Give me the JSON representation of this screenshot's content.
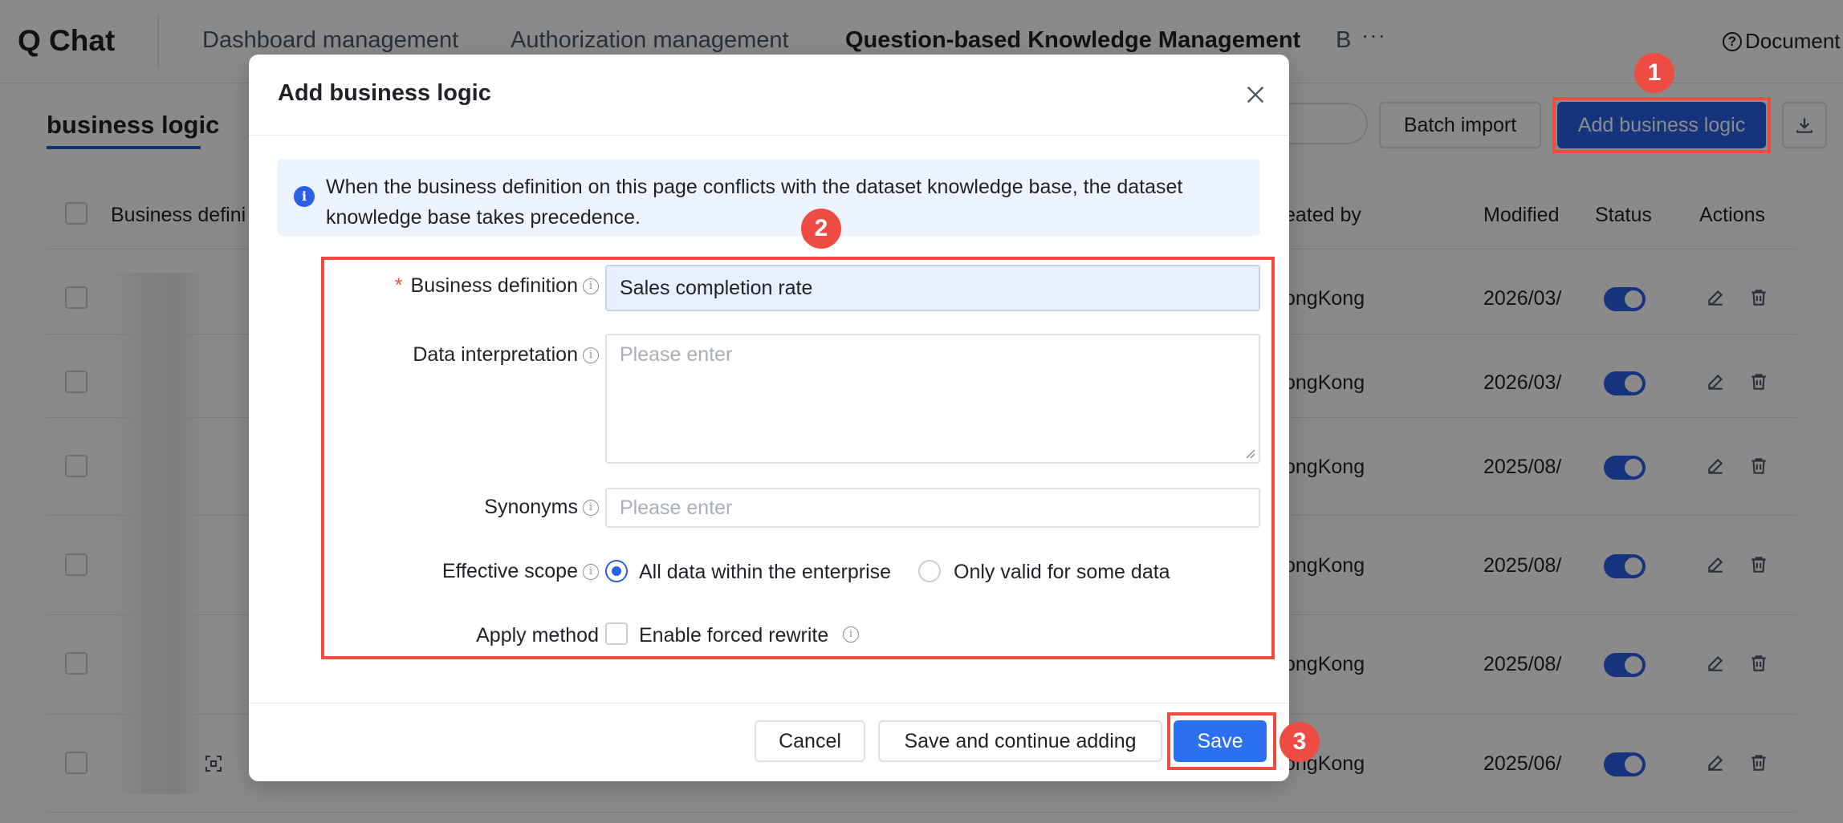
{
  "app": {
    "title": "Q Chat"
  },
  "nav": {
    "tabs": [
      {
        "label": "Dashboard management"
      },
      {
        "label": "Authorization management"
      },
      {
        "label": "Question-based Knowledge Management"
      },
      {
        "label": "B"
      }
    ],
    "more": "···",
    "document": "Document"
  },
  "page": {
    "subtab": "business logic",
    "batch_import": "Batch import",
    "add_button": "Add business logic"
  },
  "table": {
    "columns": {
      "business_definition": "Business defini",
      "created_by": "eated by",
      "modified": "Modified",
      "status": "Status",
      "actions": "Actions"
    },
    "rows": [
      {
        "created_by": "ongKong",
        "modified": "2026/03/",
        "status": true
      },
      {
        "created_by": "ongKong",
        "modified": "2026/03/",
        "status": true
      },
      {
        "created_by": "ongKong",
        "modified": "2025/08/",
        "status": true
      },
      {
        "created_by": "ongKong",
        "modified": "2025/08/",
        "status": true
      },
      {
        "created_by": "ongKong",
        "modified": "2025/08/",
        "status": true
      },
      {
        "created_by": "ongKong",
        "modified": "2025/06/",
        "status": true
      }
    ]
  },
  "modal": {
    "title": "Add business logic",
    "info": "When the business definition on this page conflicts with the dataset knowledge base, the dataset knowledge base takes precedence.",
    "fields": {
      "business_definition": {
        "label": "Business definition",
        "value": "Sales completion rate"
      },
      "data_interpretation": {
        "label": "Data interpretation",
        "placeholder": "Please enter"
      },
      "synonyms": {
        "label": "Synonyms",
        "placeholder": "Please enter"
      },
      "effective_scope": {
        "label": "Effective scope",
        "options": [
          "All data within the enterprise",
          "Only valid for some data"
        ],
        "selected": "All data within the enterprise"
      },
      "apply_method": {
        "label": "Apply method",
        "checkbox_label": "Enable forced rewrite",
        "checked": false
      }
    },
    "buttons": {
      "cancel": "Cancel",
      "save_continue": "Save and continue adding",
      "save": "Save"
    }
  },
  "annotations": {
    "badge1": "1",
    "badge2": "2",
    "badge3": "3"
  },
  "colors": {
    "accent": "#2860e8",
    "highlight": "#ee4b42",
    "info_bg": "#eef4ff"
  }
}
